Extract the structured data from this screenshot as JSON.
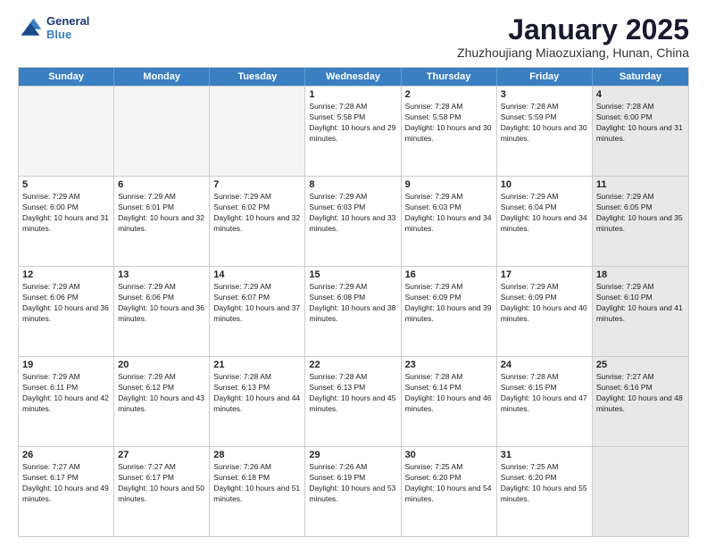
{
  "header": {
    "logo_line1": "General",
    "logo_line2": "Blue",
    "month_title": "January 2025",
    "subtitle": "Zhuzhoujiang Miaozuxiang, Hunan, China"
  },
  "weekdays": [
    "Sunday",
    "Monday",
    "Tuesday",
    "Wednesday",
    "Thursday",
    "Friday",
    "Saturday"
  ],
  "rows": [
    [
      {
        "day": "",
        "empty": true
      },
      {
        "day": "",
        "empty": true
      },
      {
        "day": "",
        "empty": true
      },
      {
        "day": "1",
        "rise": "7:28 AM",
        "set": "5:58 PM",
        "daylight": "10 hours and 29 minutes."
      },
      {
        "day": "2",
        "rise": "7:28 AM",
        "set": "5:58 PM",
        "daylight": "10 hours and 30 minutes."
      },
      {
        "day": "3",
        "rise": "7:28 AM",
        "set": "5:59 PM",
        "daylight": "10 hours and 30 minutes."
      },
      {
        "day": "4",
        "rise": "7:28 AM",
        "set": "6:00 PM",
        "daylight": "10 hours and 31 minutes.",
        "shaded": true
      }
    ],
    [
      {
        "day": "5",
        "rise": "7:29 AM",
        "set": "6:00 PM",
        "daylight": "10 hours and 31 minutes."
      },
      {
        "day": "6",
        "rise": "7:29 AM",
        "set": "6:01 PM",
        "daylight": "10 hours and 32 minutes."
      },
      {
        "day": "7",
        "rise": "7:29 AM",
        "set": "6:02 PM",
        "daylight": "10 hours and 32 minutes."
      },
      {
        "day": "8",
        "rise": "7:29 AM",
        "set": "6:03 PM",
        "daylight": "10 hours and 33 minutes."
      },
      {
        "day": "9",
        "rise": "7:29 AM",
        "set": "6:03 PM",
        "daylight": "10 hours and 34 minutes."
      },
      {
        "day": "10",
        "rise": "7:29 AM",
        "set": "6:04 PM",
        "daylight": "10 hours and 34 minutes."
      },
      {
        "day": "11",
        "rise": "7:29 AM",
        "set": "6:05 PM",
        "daylight": "10 hours and 35 minutes.",
        "shaded": true
      }
    ],
    [
      {
        "day": "12",
        "rise": "7:29 AM",
        "set": "6:06 PM",
        "daylight": "10 hours and 36 minutes."
      },
      {
        "day": "13",
        "rise": "7:29 AM",
        "set": "6:06 PM",
        "daylight": "10 hours and 36 minutes."
      },
      {
        "day": "14",
        "rise": "7:29 AM",
        "set": "6:07 PM",
        "daylight": "10 hours and 37 minutes."
      },
      {
        "day": "15",
        "rise": "7:29 AM",
        "set": "6:08 PM",
        "daylight": "10 hours and 38 minutes."
      },
      {
        "day": "16",
        "rise": "7:29 AM",
        "set": "6:09 PM",
        "daylight": "10 hours and 39 minutes."
      },
      {
        "day": "17",
        "rise": "7:29 AM",
        "set": "6:09 PM",
        "daylight": "10 hours and 40 minutes."
      },
      {
        "day": "18",
        "rise": "7:29 AM",
        "set": "6:10 PM",
        "daylight": "10 hours and 41 minutes.",
        "shaded": true
      }
    ],
    [
      {
        "day": "19",
        "rise": "7:29 AM",
        "set": "6:11 PM",
        "daylight": "10 hours and 42 minutes."
      },
      {
        "day": "20",
        "rise": "7:29 AM",
        "set": "6:12 PM",
        "daylight": "10 hours and 43 minutes."
      },
      {
        "day": "21",
        "rise": "7:28 AM",
        "set": "6:13 PM",
        "daylight": "10 hours and 44 minutes."
      },
      {
        "day": "22",
        "rise": "7:28 AM",
        "set": "6:13 PM",
        "daylight": "10 hours and 45 minutes."
      },
      {
        "day": "23",
        "rise": "7:28 AM",
        "set": "6:14 PM",
        "daylight": "10 hours and 46 minutes."
      },
      {
        "day": "24",
        "rise": "7:28 AM",
        "set": "6:15 PM",
        "daylight": "10 hours and 47 minutes."
      },
      {
        "day": "25",
        "rise": "7:27 AM",
        "set": "6:16 PM",
        "daylight": "10 hours and 48 minutes.",
        "shaded": true
      }
    ],
    [
      {
        "day": "26",
        "rise": "7:27 AM",
        "set": "6:17 PM",
        "daylight": "10 hours and 49 minutes."
      },
      {
        "day": "27",
        "rise": "7:27 AM",
        "set": "6:17 PM",
        "daylight": "10 hours and 50 minutes."
      },
      {
        "day": "28",
        "rise": "7:26 AM",
        "set": "6:18 PM",
        "daylight": "10 hours and 51 minutes."
      },
      {
        "day": "29",
        "rise": "7:26 AM",
        "set": "6:19 PM",
        "daylight": "10 hours and 53 minutes."
      },
      {
        "day": "30",
        "rise": "7:25 AM",
        "set": "6:20 PM",
        "daylight": "10 hours and 54 minutes."
      },
      {
        "day": "31",
        "rise": "7:25 AM",
        "set": "6:20 PM",
        "daylight": "10 hours and 55 minutes."
      },
      {
        "day": "",
        "empty": true,
        "shaded": true
      }
    ]
  ],
  "labels": {
    "sunrise": "Sunrise:",
    "sunset": "Sunset:",
    "daylight": "Daylight:"
  }
}
